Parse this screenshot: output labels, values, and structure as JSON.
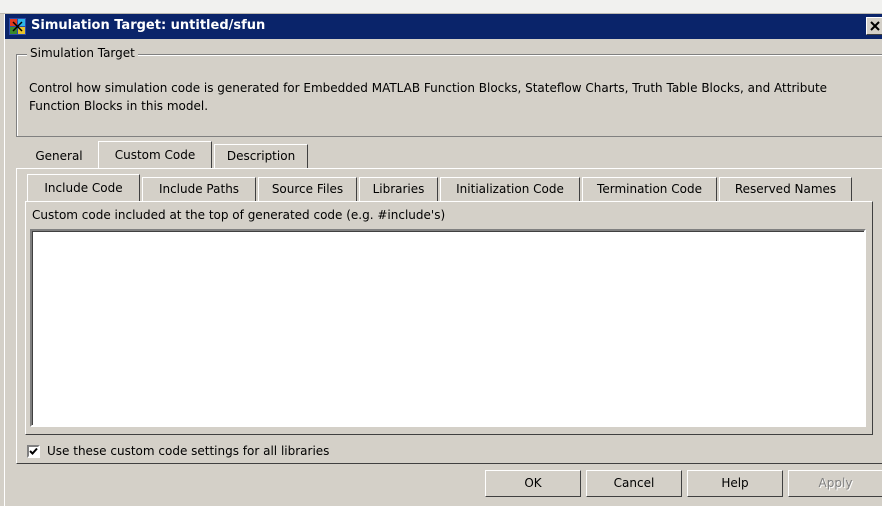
{
  "window": {
    "title": "Simulation Target: untitled/sfun",
    "icon": "simulink-model-icon",
    "close_icon": "close-icon"
  },
  "group": {
    "legend": "Simulation Target",
    "description": "Control how simulation code is generated for Embedded MATLAB Function Blocks, Stateflow Charts, Truth Table Blocks, and Attribute Function Blocks in this model."
  },
  "main_tabs": [
    {
      "label": "General",
      "selected": false
    },
    {
      "label": "Custom Code",
      "selected": true
    },
    {
      "label": "Description",
      "selected": false
    }
  ],
  "sub_tabs": [
    {
      "label": "Include Code",
      "selected": true
    },
    {
      "label": "Include Paths",
      "selected": false
    },
    {
      "label": "Source Files",
      "selected": false
    },
    {
      "label": "Libraries",
      "selected": false
    },
    {
      "label": "Initialization Code",
      "selected": false
    },
    {
      "label": "Termination Code",
      "selected": false
    },
    {
      "label": "Reserved Names",
      "selected": false
    }
  ],
  "include_code": {
    "label": "Custom code included at the top of generated code (e.g. #include's)",
    "value": ""
  },
  "checkbox": {
    "label": "Use these custom code settings for all libraries",
    "checked": true
  },
  "buttons": {
    "ok": "OK",
    "cancel": "Cancel",
    "help": "Help",
    "apply": "Apply",
    "apply_enabled": false
  },
  "colors": {
    "titlebar": "#0a246a",
    "face": "#d4d0c8"
  }
}
